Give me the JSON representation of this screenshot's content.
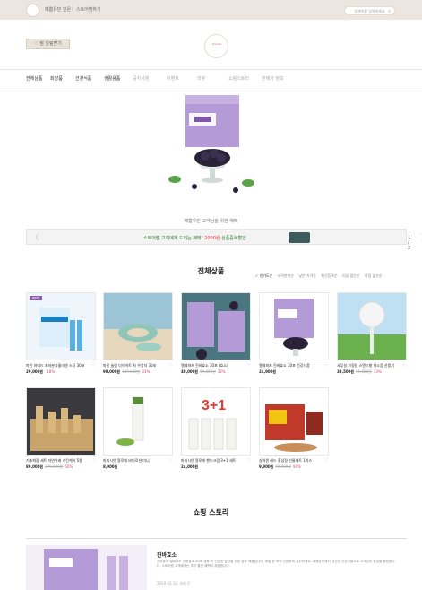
{
  "topbar": {
    "store_name": "예쁨유민 안온",
    "separator": "|",
    "link": "스토어찜하기",
    "search_placeholder": "검색어를 입력하세요"
  },
  "header": {
    "favorite_button": "찜 알림받기",
    "logo_text": "Yeomin"
  },
  "nav": {
    "items": [
      {
        "label": "전체상품",
        "active": true
      },
      {
        "label": "화장품",
        "active": true
      },
      {
        "label": "건강식품",
        "active": true
      },
      {
        "label": "생활용품",
        "active": true
      },
      {
        "label": "공지사항",
        "active": false
      },
      {
        "label": "이벤트",
        "active": false
      },
      {
        "label": "리뷰",
        "active": false
      },
      {
        "label": "쇼핑스토리",
        "active": false
      },
      {
        "label": "판매자 정보",
        "active": false
      }
    ]
  },
  "hero": {
    "caption": "예쁨유민 고객님을 위한 혜택"
  },
  "banner": {
    "prev": "〈",
    "next": "〉",
    "text": "스토어찜 고객에게 드리는 혜택! 2000원 상품중복할인",
    "page": "1 / 2"
  },
  "products_section": {
    "title": "전체상품",
    "sort_options": [
      "✓ 인기도순",
      "누적판매순",
      "낮은 가격순",
      "최신등록순",
      "리뷰 많은순",
      "평점 높은순"
    ],
    "products": [
      {
        "name": "마린 하이드 초저분자콜라겐 스틱 30포",
        "price": "29,000원",
        "original": "",
        "discount": "18%",
        "badge": "BEST"
      },
      {
        "name": "마린 슬림 다이어트 차 우엉차 30포",
        "price": "99,000원",
        "original": "149,000원",
        "discount": "33%",
        "badge": ""
      },
      {
        "name": "엘레파츠 진바효소 30포 (효소)",
        "price": "40,000원",
        "original": "59,000원",
        "discount": "32%",
        "badge": ""
      },
      {
        "name": "엘레파츠 진바효소 30포 건강식품",
        "price": "24,900원",
        "original": "",
        "discount": "",
        "badge": ""
      },
      {
        "name": "사무실 가정용 스탠드형 저소음 선풍기",
        "price": "39,500원",
        "original": "59,000원",
        "discount": "33%",
        "badge": ""
      },
      {
        "name": "기초화장 세트 자연유래 스킨케어 5종",
        "price": "89,000원",
        "original": "179,000원",
        "discount": "50%",
        "badge": ""
      },
      {
        "name": "마미시안 알로에 바디로션 미니",
        "price": "8,000원",
        "original": "",
        "discount": "",
        "badge": ""
      },
      {
        "name": "마미시안 알로에 핸드크림 3+1 세트",
        "price": "24,000원",
        "original": "",
        "discount": "",
        "badge": ""
      },
      {
        "name": "실버퀸 레드 홍삼정 선물세트 1박스",
        "price": "9,900원",
        "original": "99,000원",
        "discount": "90%",
        "badge": ""
      }
    ]
  },
  "story_section": {
    "title": "쇼핑 스토리",
    "post_title": "진바효소",
    "post_text": "진바효소 엘레파츠 진바효소 30포 생활 속 건강한 습관을 위한 효소 제품입니다. 매일 한 포씩 간편하게 섭취하세요. 예쁨유민에서 엄선한 건강식품으로 고객님의 일상을 응원합니다. 스토어찜 고객에게는 추가 할인 혜택이 제공됩니다.",
    "post_date": "2020.03.13. 조회 0"
  },
  "colors": {
    "topbar_bg": "#ede6e0",
    "accent": "#8b5fb0",
    "banner_highlight": "#e53935",
    "discount": "#d64b6a"
  }
}
